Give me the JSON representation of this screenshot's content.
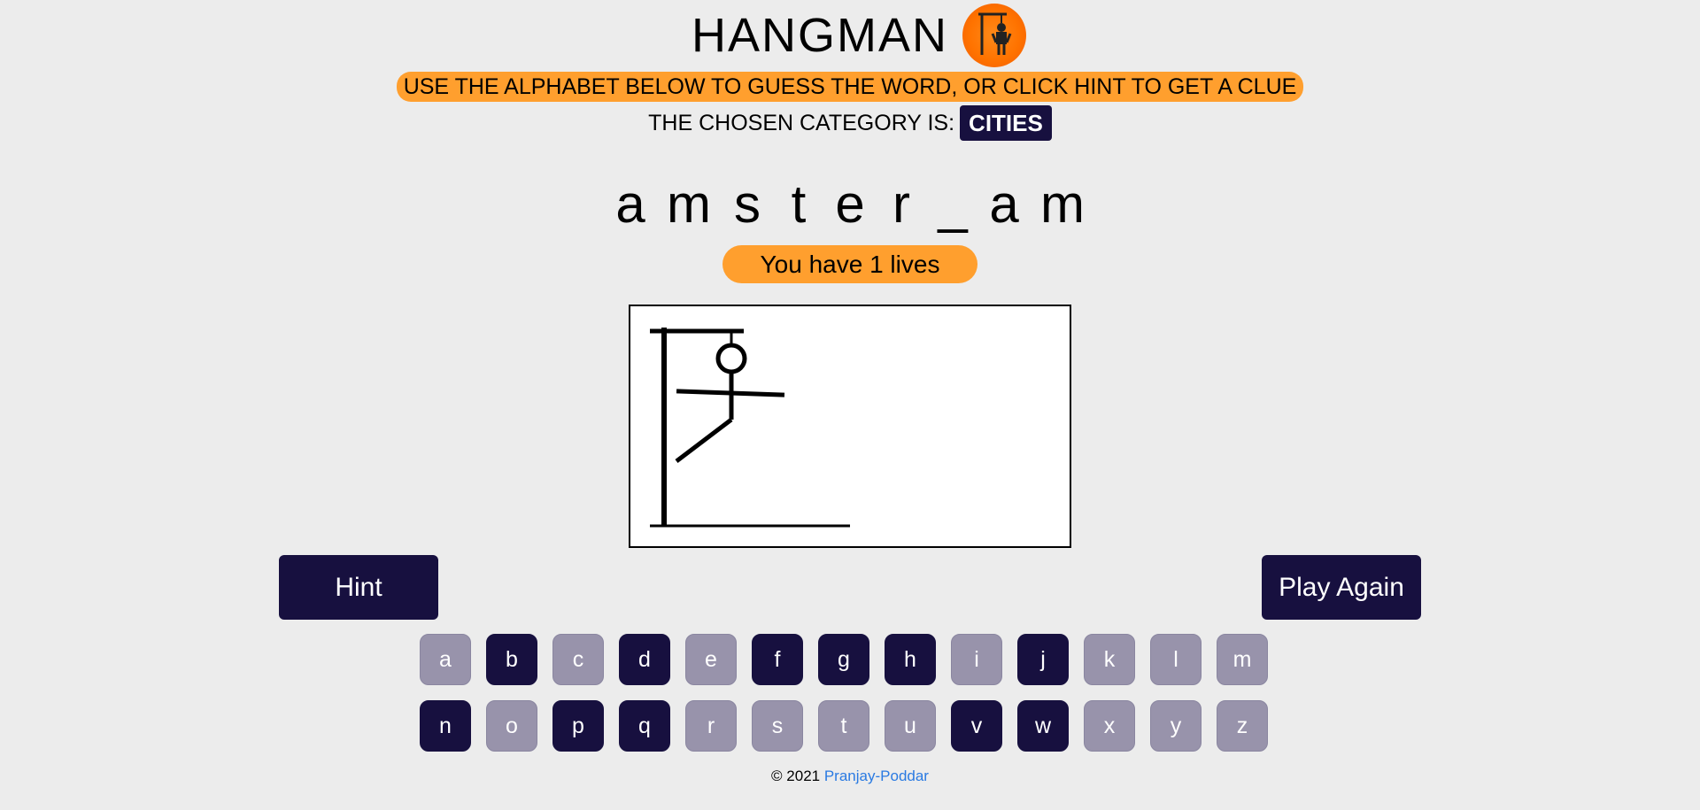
{
  "header": {
    "title": "HANGMAN",
    "logo_icon": "hangman-logo-icon"
  },
  "instructions": "USE THE ALPHABET BELOW TO GUESS THE WORD, OR CLICK HINT TO GET A CLUE",
  "category": {
    "label": "THE CHOSEN CATEGORY IS:",
    "value": "CITIES"
  },
  "word": [
    "a",
    "m",
    "s",
    "t",
    "e",
    "r",
    "_",
    "a",
    "m"
  ],
  "lives_text": "You have 1 lives",
  "hangman_drawing": {
    "parts_shown": [
      "base",
      "pole",
      "beam",
      "rope",
      "head",
      "body",
      "arms",
      "left-leg"
    ]
  },
  "buttons": {
    "hint": "Hint",
    "play_again": "Play Again"
  },
  "keyboard": {
    "row1": [
      {
        "letter": "a",
        "used": true
      },
      {
        "letter": "b",
        "used": false
      },
      {
        "letter": "c",
        "used": true
      },
      {
        "letter": "d",
        "used": false
      },
      {
        "letter": "e",
        "used": true
      },
      {
        "letter": "f",
        "used": false
      },
      {
        "letter": "g",
        "used": false
      },
      {
        "letter": "h",
        "used": false
      },
      {
        "letter": "i",
        "used": true
      },
      {
        "letter": "j",
        "used": false
      },
      {
        "letter": "k",
        "used": true
      },
      {
        "letter": "l",
        "used": true
      },
      {
        "letter": "m",
        "used": true
      }
    ],
    "row2": [
      {
        "letter": "n",
        "used": false
      },
      {
        "letter": "o",
        "used": true
      },
      {
        "letter": "p",
        "used": false
      },
      {
        "letter": "q",
        "used": false
      },
      {
        "letter": "r",
        "used": true
      },
      {
        "letter": "s",
        "used": true
      },
      {
        "letter": "t",
        "used": true
      },
      {
        "letter": "u",
        "used": true
      },
      {
        "letter": "v",
        "used": false
      },
      {
        "letter": "w",
        "used": false
      },
      {
        "letter": "x",
        "used": true
      },
      {
        "letter": "y",
        "used": true
      },
      {
        "letter": "z",
        "used": true
      }
    ]
  },
  "colors": {
    "accent_orange": "#ff9f2e",
    "dark_navy": "#17103f",
    "used_key": "#9893ab",
    "link": "#2a7ae2"
  },
  "footer": {
    "copyright": "© 2021",
    "author_link": "Pranjay-Poddar"
  }
}
